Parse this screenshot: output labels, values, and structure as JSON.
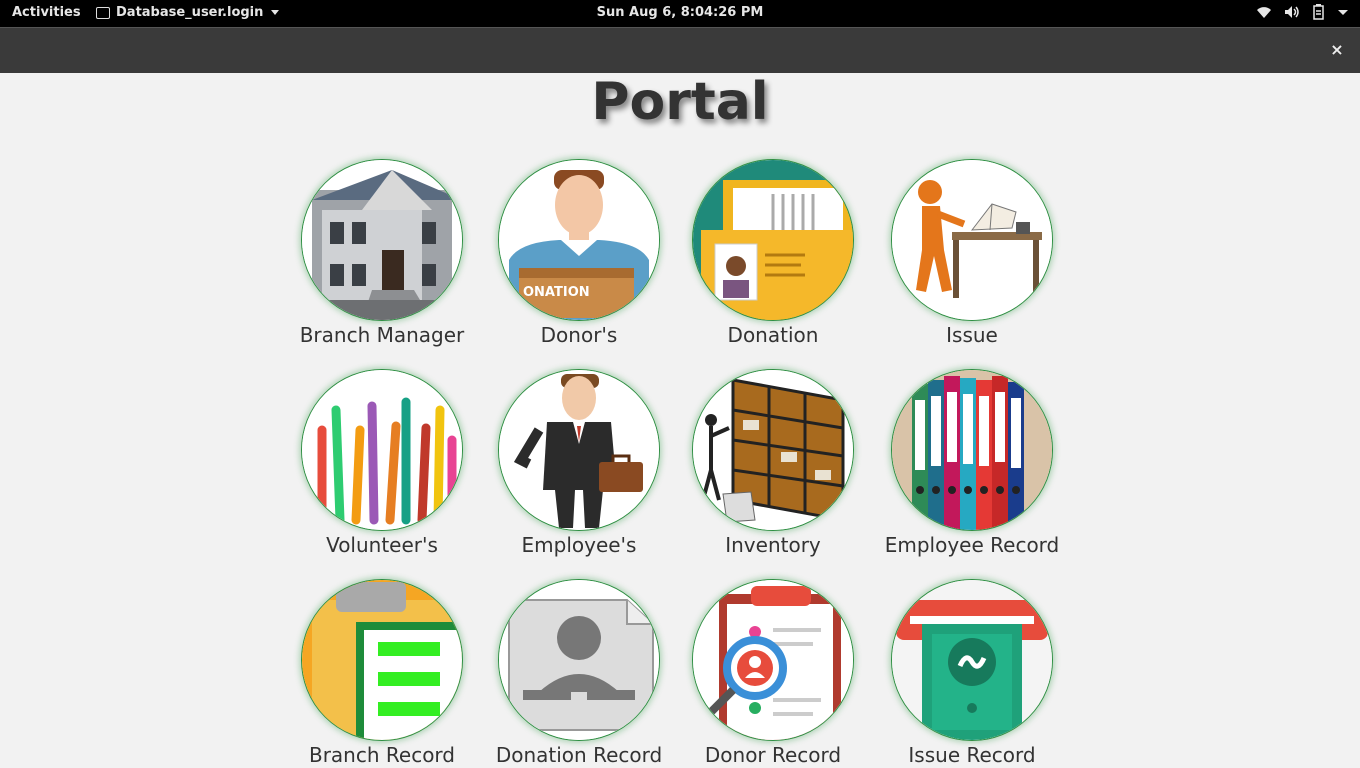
{
  "topbar": {
    "activities": "Activities",
    "app_name": "Database_user.login",
    "clock": "Sun Aug  6,  8:04:26 PM",
    "tray_icons": [
      "wifi-icon",
      "volume-icon",
      "battery-icon",
      "system-menu-caret-icon"
    ]
  },
  "window": {
    "close_label": "×"
  },
  "portal": {
    "title": "Portal",
    "tiles": [
      {
        "label": "Branch Manager",
        "icon": "building-icon"
      },
      {
        "label": "Donor's",
        "icon": "donor-icon"
      },
      {
        "label": "Donation",
        "icon": "folder-profile-icon"
      },
      {
        "label": "Issue",
        "icon": "reading-figure-icon"
      },
      {
        "label": "Volunteer's",
        "icon": "raised-hands-icon"
      },
      {
        "label": "Employee's",
        "icon": "businessman-icon"
      },
      {
        "label": "Inventory",
        "icon": "shelves-icon"
      },
      {
        "label": "Employee Record",
        "icon": "binders-icon"
      },
      {
        "label": "Branch Record",
        "icon": "clipboard-list-icon"
      },
      {
        "label": "Donation Record",
        "icon": "contact-card-icon"
      },
      {
        "label": "Donor Record",
        "icon": "search-profile-icon"
      },
      {
        "label": "Issue Record",
        "icon": "money-icon"
      }
    ]
  }
}
